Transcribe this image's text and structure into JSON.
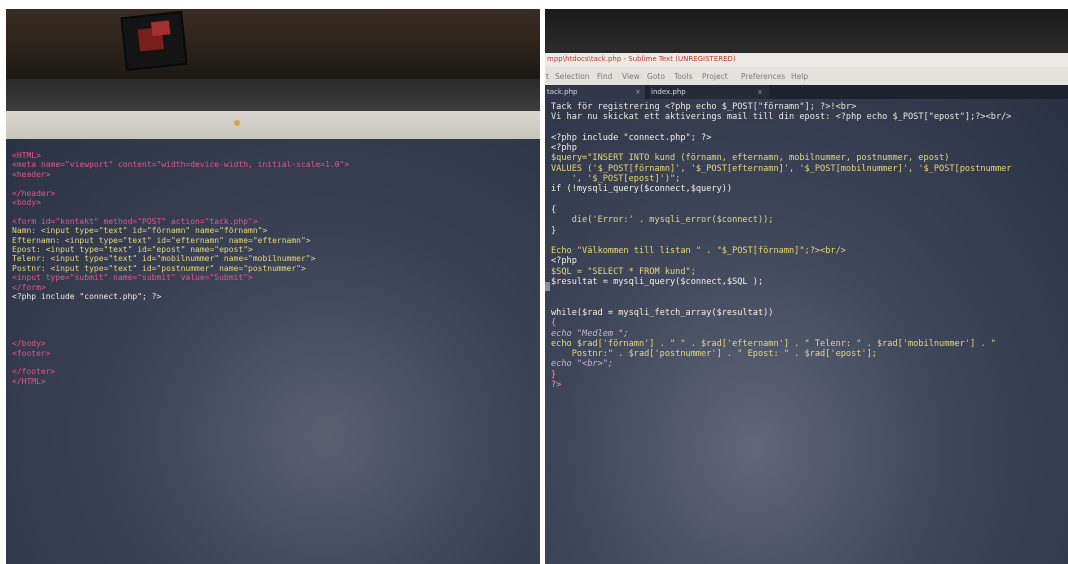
{
  "left_editor": {
    "lines": [
      "<HTML>",
      "<meta name=\"viewport\" content=\"width=device-width, initial-scale=1.0\">",
      "<header>",
      "",
      "</header>",
      "<body>",
      "",
      "<form id=\"kontakt\" method=\"POST\" action=\"tack.php\">",
      "Namn: <input type=\"text\" id=\"förnamn\" name=\"förnamn\">",
      "Efternamn: <input type=\"text\" id=\"efternamn\" name=\"efternamn\">",
      "Epost: <input type=\"text\" id=\"epost\" name=\"epost\">",
      "Telenr: <input type=\"text\" id=\"mobilnummer\" name=\"mobilnummer\">",
      "Postnr: <input type=\"text\" id=\"postnummer\" name=\"postnummer\">",
      "<input type=\"submit\" name=\"submit\" value=\"Submit\">",
      "</form>",
      "<?php include \"connect.php\"; ?>",
      "",
      "",
      "",
      "",
      "</body>",
      "<footer>",
      "",
      "</footer>",
      "</HTML>"
    ]
  },
  "right_editor": {
    "window_title": "mpp\\htdocs\\tack.php - Sublime Text (UNREGISTERED)",
    "menu": [
      "t",
      "Selection",
      "Find",
      "View",
      "Goto",
      "Tools",
      "Project",
      "Preferences",
      "Help"
    ],
    "tabs": [
      {
        "label": "tack.php",
        "active": true
      },
      {
        "label": "index.php",
        "active": false
      }
    ],
    "lines": [
      "Tack för registrering <?php echo $_POST[\"förnamn\"]; ?>!<br>",
      "Vi har nu skickat ett aktiverings mail till din epost: <?php echo $_POST[\"epost\"];?><br/>",
      "",
      "<?php include \"connect.php\"; ?>",
      "<?php",
      "$query=\"INSERT INTO kund (förnamn, efternamn, mobilnummer, postnummer, epost)",
      "VALUES ('$_POST[förnamn]', '$_POST[efternamn]', '$_POST[mobilnummer]', '$_POST[postnummer",
      "    ', '$_POST[epost]')\";",
      "if (!mysqli_query($connect,$query))",
      "",
      "{",
      "    die('Error:' . mysqli_error($connect));",
      "}",
      "",
      "Echo \"Välkommen till listan \" . \"$_POST[förnamn]\";?><br/>",
      "<?php",
      "$SQL = \"SELECT * FROM kund\";",
      "$resultat = mysqli_query($connect,$SQL );",
      "",
      "",
      "while($rad = mysqli_fetch_array($resultat))",
      "{",
      "echo \"Medlem \";",
      "echo $rad['förnamn'] . \" \" . $rad['efternamn'] . \" Telenr: \" . $rad['mobilnummer'] . \"",
      "    Postnr:\" . $rad['postnummer'] . \" Epost: \" . $rad['epost'];",
      "echo \"<br>\";",
      "}",
      "?>"
    ]
  },
  "colors": {
    "tag": "#e6548a",
    "attribute": "#a5d86a",
    "string": "#e5d97a",
    "function": "#7fd0ec",
    "keyword": "#f08db2",
    "text": "#ece9dc"
  }
}
